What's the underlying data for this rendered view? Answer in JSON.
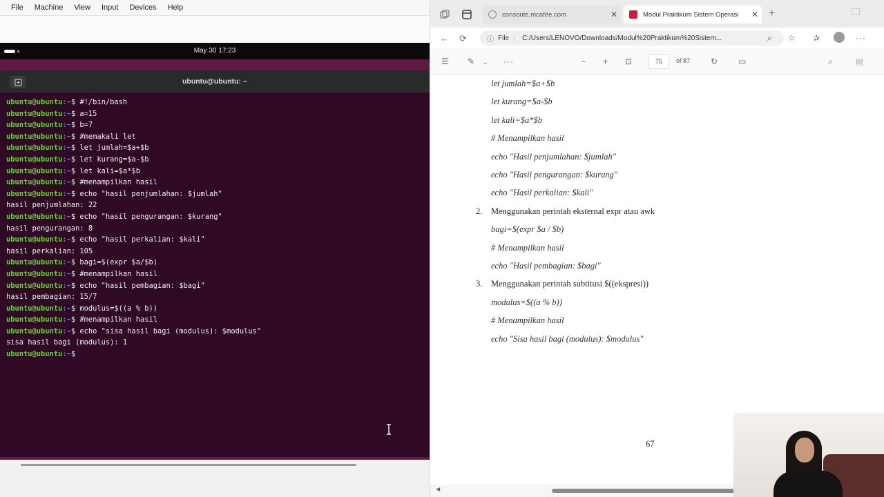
{
  "vbox": {
    "menu": [
      "File",
      "Machine",
      "View",
      "Input",
      "Devices",
      "Help"
    ]
  },
  "ubuntu": {
    "clock": "May 30  17:23"
  },
  "terminal": {
    "title": "ubuntu@ubuntu: ~",
    "prompt_user": "ubuntu@ubuntu",
    "prompt_path": ":~",
    "prompt_dollar": "$",
    "lines": [
      {
        "type": "cmd",
        "text": " #!/bin/bash"
      },
      {
        "type": "cmd",
        "text": " a=15"
      },
      {
        "type": "cmd",
        "text": " b=7"
      },
      {
        "type": "cmd",
        "text": " #memakali let"
      },
      {
        "type": "cmd",
        "text": " let jumlah=$a+$b"
      },
      {
        "type": "cmd",
        "text": " let kurang=$a-$b"
      },
      {
        "type": "cmd",
        "text": " let kali=$a*$b"
      },
      {
        "type": "cmd",
        "text": " #menampilkan hasil"
      },
      {
        "type": "cmd",
        "text": " echo \"hasil penjumlahan: $jumlah\""
      },
      {
        "type": "out",
        "text": "hasil penjumlahan: 22"
      },
      {
        "type": "cmd",
        "text": " echo \"hasil pengurangan: $kurang\""
      },
      {
        "type": "out",
        "text": "hasil pengurangan: 8"
      },
      {
        "type": "cmd",
        "text": " echo \"hasil perkalian: $kali\""
      },
      {
        "type": "out",
        "text": "hasil perkalian: 105"
      },
      {
        "type": "cmd",
        "text": " bagi=$(expr $a/$b)"
      },
      {
        "type": "cmd",
        "text": " #menampilkan hasil"
      },
      {
        "type": "cmd",
        "text": " echo \"hasil pembagian: $bagi\""
      },
      {
        "type": "out",
        "text": "hasil pembagian: 15/7"
      },
      {
        "type": "cmd",
        "text": " modulus=$((a % b))"
      },
      {
        "type": "cmd",
        "text": " #menampilkan hasil"
      },
      {
        "type": "cmd",
        "text": " echo \"sisa hasil bagi (modulus): $modulus\""
      },
      {
        "type": "out",
        "text": "sisa hasil bagi (modulus): 1"
      },
      {
        "type": "cmd",
        "text": " "
      }
    ]
  },
  "browser": {
    "tabs": [
      {
        "title": "consoute.mcafee.com",
        "active": false
      },
      {
        "title": "Modul Praktikum Sistem Operasi",
        "active": true
      }
    ],
    "address": {
      "scheme_label": "File",
      "url": "C:/Users/LENOVO/Downloads/Modul%20Praktikum%20Sistem..."
    },
    "pdf": {
      "page_input": "75",
      "page_of": "of 87",
      "lines": [
        {
          "text": "let jumlah=$a+$b",
          "italic": true
        },
        {
          "text": "let kurang=$a-$b",
          "italic": true
        },
        {
          "text": "let kali=$a*$b",
          "italic": true
        },
        {
          "text": "# Menampilkan hasil",
          "italic": true
        },
        {
          "text": "echo \"Hasil penjumlahan: $jumlah\"",
          "italic": true
        },
        {
          "text": "echo \"Hasil pengurangan: $kurang\"",
          "italic": true
        },
        {
          "text": "echo \"Hasil perkalian: $kali\"",
          "italic": true
        },
        {
          "num": "2.",
          "text": "Menggunakan perintah eksternal expr atau awk",
          "italic": false
        },
        {
          "text": "bagi=$(expr $a / $b)",
          "italic": true
        },
        {
          "text": "# Menampilkan hasil",
          "italic": true
        },
        {
          "text": "echo \"Hasil pembagian: $bagi\"",
          "italic": true
        },
        {
          "num": "3.",
          "text": "Menggunakan perintah subtitusi  $((ekspresi))",
          "italic": false
        },
        {
          "text": "modulus=$((a % b))",
          "italic": true
        },
        {
          "text": "# Menampilkan hasil",
          "italic": true
        },
        {
          "text": "echo \"Sisa hasil bagi (modulus): $modulus\"",
          "italic": true
        }
      ],
      "page_number": "67"
    }
  }
}
